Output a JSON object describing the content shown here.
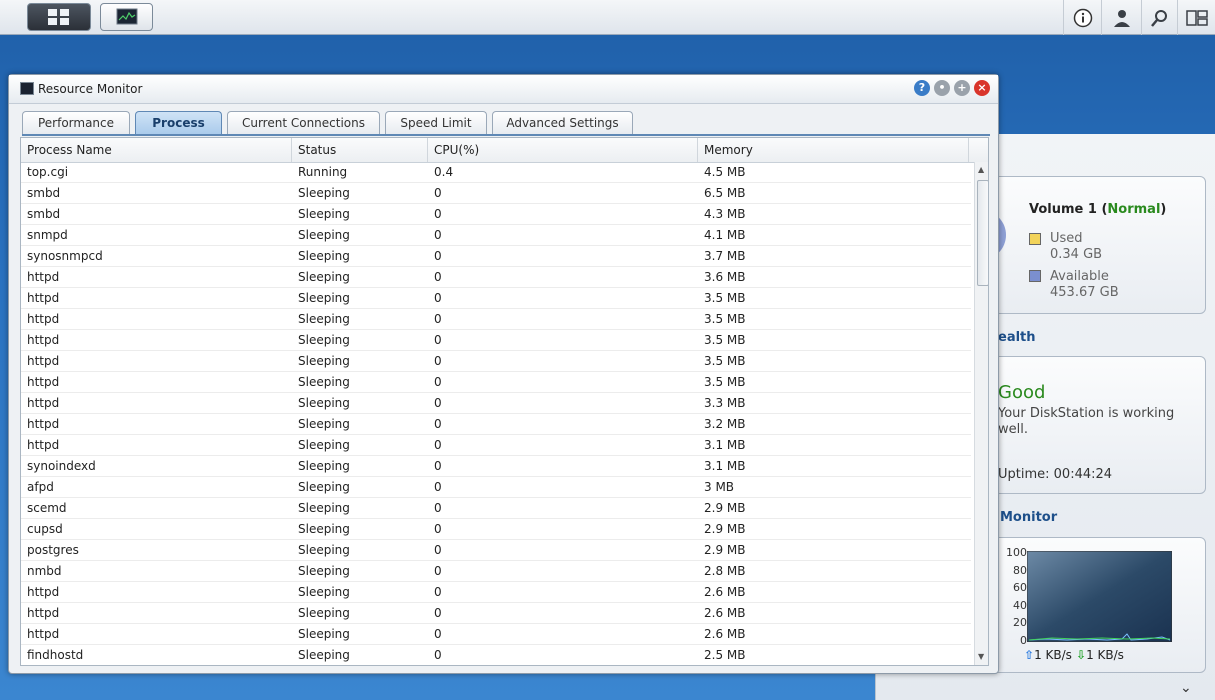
{
  "window": {
    "title": "Resource Monitor",
    "tabs": [
      {
        "label": "Performance"
      },
      {
        "label": "Process"
      },
      {
        "label": "Current Connections"
      },
      {
        "label": "Speed Limit"
      },
      {
        "label": "Advanced Settings"
      }
    ],
    "active_tab": "Process"
  },
  "table": {
    "columns": [
      "Process Name",
      "Status",
      "CPU(%)",
      "Memory"
    ],
    "rows": [
      [
        "top.cgi",
        "Running",
        "0.4",
        "4.5 MB"
      ],
      [
        "smbd",
        "Sleeping",
        "0",
        "6.5 MB"
      ],
      [
        "smbd",
        "Sleeping",
        "0",
        "4.3 MB"
      ],
      [
        "snmpd",
        "Sleeping",
        "0",
        "4.1 MB"
      ],
      [
        "synosnmpcd",
        "Sleeping",
        "0",
        "3.7 MB"
      ],
      [
        "httpd",
        "Sleeping",
        "0",
        "3.6 MB"
      ],
      [
        "httpd",
        "Sleeping",
        "0",
        "3.5 MB"
      ],
      [
        "httpd",
        "Sleeping",
        "0",
        "3.5 MB"
      ],
      [
        "httpd",
        "Sleeping",
        "0",
        "3.5 MB"
      ],
      [
        "httpd",
        "Sleeping",
        "0",
        "3.5 MB"
      ],
      [
        "httpd",
        "Sleeping",
        "0",
        "3.5 MB"
      ],
      [
        "httpd",
        "Sleeping",
        "0",
        "3.3 MB"
      ],
      [
        "httpd",
        "Sleeping",
        "0",
        "3.2 MB"
      ],
      [
        "httpd",
        "Sleeping",
        "0",
        "3.1 MB"
      ],
      [
        "synoindexd",
        "Sleeping",
        "0",
        "3.1 MB"
      ],
      [
        "afpd",
        "Sleeping",
        "0",
        "3 MB"
      ],
      [
        "scemd",
        "Sleeping",
        "0",
        "2.9 MB"
      ],
      [
        "cupsd",
        "Sleeping",
        "0",
        "2.9 MB"
      ],
      [
        "postgres",
        "Sleeping",
        "0",
        "2.9 MB"
      ],
      [
        "nmbd",
        "Sleeping",
        "0",
        "2.8 MB"
      ],
      [
        "httpd",
        "Sleeping",
        "0",
        "2.6 MB"
      ],
      [
        "httpd",
        "Sleeping",
        "0",
        "2.6 MB"
      ],
      [
        "httpd",
        "Sleeping",
        "0",
        "2.6 MB"
      ],
      [
        "findhostd",
        "Sleeping",
        "0",
        "2.5 MB"
      ]
    ]
  },
  "volume": {
    "name": "Volume 1",
    "status": "Normal",
    "used_label": "Used",
    "used_value": "0.34 GB",
    "available_label": "Available",
    "available_value": "453.67 GB",
    "used_color": "#f2d35a",
    "available_color": "#7b8fcf"
  },
  "health": {
    "heading": "ealth",
    "status": "Good",
    "message": "Your DiskStation is working well.",
    "uptime": "Uptime: 00:44:24"
  },
  "monitor": {
    "heading": "Monitor",
    "y_ticks": [
      "100",
      "80",
      "60",
      "40",
      "20",
      "0"
    ],
    "upload": "1 KB/s",
    "download": "1 KB/s"
  },
  "icons": {
    "taskbar": [
      "main-menu-icon",
      "resource-monitor-icon",
      "info-icon",
      "user-icon",
      "search-icon",
      "widgets-icon"
    ],
    "window_controls": [
      "help-icon",
      "minimize-icon",
      "maximize-icon",
      "close-icon"
    ]
  },
  "colors": {
    "accent": "#1d4f8a",
    "good": "#2a8a1e",
    "close": "#d9352b",
    "help": "#3a7cc7"
  }
}
